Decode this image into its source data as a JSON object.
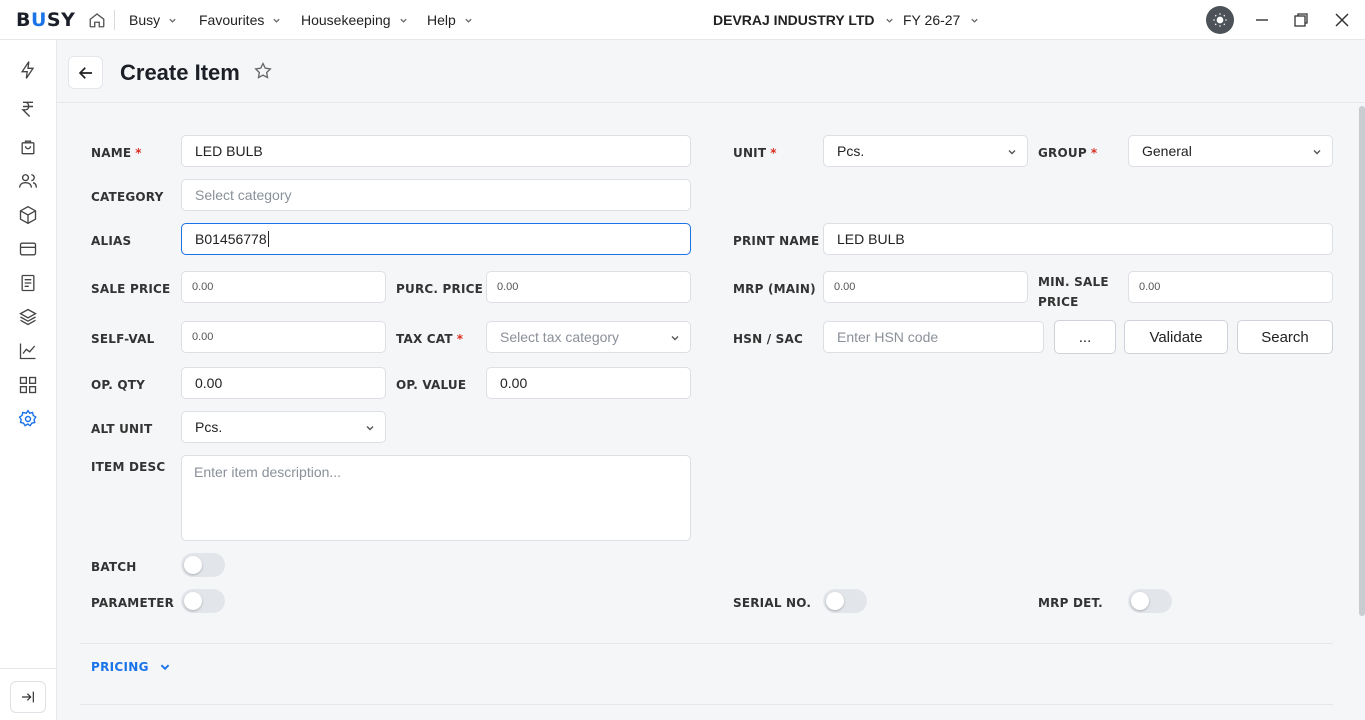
{
  "app": {
    "logo_prefix": "B",
    "logo_accent": "U",
    "logo_suffix": "SY",
    "accent_color": "#1a73e8",
    "required_color": "#d93025"
  },
  "topbar": {
    "menus": [
      {
        "label": "Busy"
      },
      {
        "label": "Favourites"
      },
      {
        "label": "Housekeeping"
      },
      {
        "label": "Help"
      }
    ],
    "company": "DEVRAJ INDUSTRY LTD",
    "fiscal_year": "FY 26-27"
  },
  "sidebar": {
    "icons": [
      "lightning-icon",
      "rupee-icon",
      "shopping-bag-icon",
      "users-icon",
      "box-icon",
      "credit-card-icon",
      "document-icon",
      "layers-icon",
      "chart-line-icon",
      "grid-icon",
      "settings-icon"
    ],
    "active": "settings-icon"
  },
  "page": {
    "title": "Create Item"
  },
  "form": {
    "name": {
      "label": "NAME",
      "value": "LED BULB"
    },
    "category": {
      "label": "CATEGORY",
      "placeholder": "Select category"
    },
    "alias": {
      "label": "ALIAS",
      "value": "B01456778"
    },
    "sale_price": {
      "label": "SALE PRICE",
      "value": "0.00"
    },
    "purc_price": {
      "label": "PURC. PRICE",
      "value": "0.00"
    },
    "self_val": {
      "label": "SELF-VAL",
      "value": "0.00"
    },
    "tax_cat": {
      "label": "TAX CAT",
      "placeholder": "Select tax category"
    },
    "op_qty": {
      "label": "OP. QTY",
      "value": "0.00"
    },
    "op_value": {
      "label": "OP. VALUE",
      "value": "0.00"
    },
    "alt_unit": {
      "label": "ALT UNIT",
      "value": "Pcs."
    },
    "item_desc": {
      "label": "ITEM DESC",
      "placeholder": "Enter item description..."
    },
    "batch": {
      "label": "BATCH"
    },
    "parameter": {
      "label": "PARAMETER"
    },
    "unit": {
      "label": "UNIT",
      "value": "Pcs."
    },
    "group": {
      "label": "GROUP",
      "value": "General"
    },
    "print_name": {
      "label": "PRINT NAME",
      "value": "LED BULB"
    },
    "mrp_main": {
      "label": "MRP (MAIN)",
      "value": "0.00"
    },
    "min_sale_price": {
      "label_line1": "MIN. SALE",
      "label_line2": "PRICE",
      "value": "0.00"
    },
    "hsn": {
      "label": "HSN / SAC",
      "placeholder": "Enter HSN code"
    },
    "hsn_more_label": "...",
    "validate_label": "Validate",
    "search_label": "Search",
    "serial_no": {
      "label": "SERIAL NO."
    },
    "mrp_det": {
      "label": "MRP DET."
    },
    "required_mark": "*"
  },
  "sections": {
    "pricing": "PRICING"
  }
}
